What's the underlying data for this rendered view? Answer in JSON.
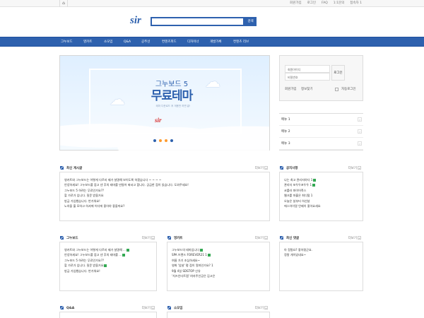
{
  "top": {
    "home": "⌂",
    "links": [
      "회원가입",
      "로그인",
      "FAQ",
      "1:1문의",
      "접속자 1"
    ]
  },
  "header": {
    "logo": "sir",
    "search_button": "검색"
  },
  "nav": [
    "그누보드",
    "영카트",
    "소모임",
    "Q&A",
    "공주선",
    "컨텐츠피드",
    "디자이너",
    "개발가록",
    "컨텐츠 리브"
  ],
  "banner": {
    "title": "그누보드 5",
    "headline": "무료테마",
    "subtitle": "테마 다운로드 후 게용만 하면 끝!",
    "logo": "sir"
  },
  "login": {
    "id_placeholder": "회원아이디",
    "pw_placeholder": "비밀번호",
    "button": "로그인",
    "join": "회원가입",
    "find": "정보찾기",
    "auto": "자동로그인"
  },
  "menu": [
    "메뉴 1",
    "메뉴 2",
    "메뉴 3"
  ],
  "more_label": "더보기",
  "boards": {
    "latest": {
      "title": "최신 게시글",
      "items": [
        "영카트와 그누보드는 어떻게 다르지 제가 설명해 보이도록 하겠습니다 ~ ~ ~ ~",
        "안녕하세요! 그누보드를 접고 낸 후의 테마를 만들어 봐서고 합니다. 궁금한 점이 있습니다. 도와주세요!",
        "그누보드 5 하려는 무료인가요??",
        "할 가로가 입니다. 질문 받을거요",
        "방금 가입했습니다. 반가워요!",
        "노하을 흘 모하고 하셔에 어디에 좋아야 좋을까요?"
      ]
    },
    "notice": {
      "title": "공지사항",
      "items": [
        "나는 최고 관리자야다 1",
        "관리자 포두두포두두 1",
        "코를라 파이어폭스",
        "웹크를 마흘은 최디털 1",
        "오늘은 날부터 하선날",
        "에스아이알 언제이 좋아요세요"
      ]
    },
    "gnuboard": {
      "title": "그누보드",
      "items": [
        "영카트와 그누보드는 어떻게 다르지 제가 설명해 ...",
        "안녕하세요! 그누보드를 접고 낸 후의 테마를 ...",
        "그누보드 5 하려는 무료인가요??",
        "할 가로가 입니다. 질문 받을거요",
        "방금 가입했습니다. 반가워요!"
      ]
    },
    "youngcart": {
      "title": "영카트",
      "items": [
        "그누보드의 테마입니다",
        "SPA 브랜드 FOREVER21 1",
        "여름 가기 조심하세요~",
        "영화 '암살' 평 점이 얼마인가요? 1",
        "9월 4일 SDSTOP 신유",
        "'치즈인더트랩' 여자주인공은 김고은"
      ]
    },
    "comments": {
      "title": "최신 댓글",
      "items": [
        "아 정말요? 좋아졌군요.",
        "정말 개이있네요~"
      ]
    },
    "qa": {
      "title": "Q&A"
    },
    "club": {
      "title": "소모임"
    }
  },
  "colors": {
    "primary": "#2e61ae",
    "accent": "#ff9b2f",
    "new_badge": "#34a853"
  }
}
